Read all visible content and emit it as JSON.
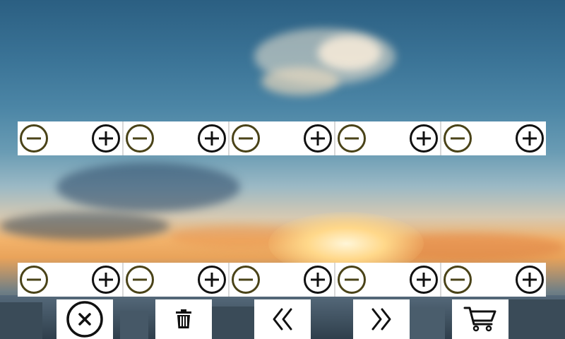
{
  "app": {
    "title": ""
  },
  "background": {
    "icon": "sunset-sky-background"
  },
  "stepper_rows": [
    {
      "steppers": [
        {
          "minus_icon": "minus-circle-icon",
          "plus_icon": "plus-circle-icon"
        },
        {
          "minus_icon": "minus-circle-icon",
          "plus_icon": "plus-circle-icon"
        },
        {
          "minus_icon": "minus-circle-icon",
          "plus_icon": "plus-circle-icon"
        },
        {
          "minus_icon": "minus-circle-icon",
          "plus_icon": "plus-circle-icon"
        },
        {
          "minus_icon": "minus-circle-icon",
          "plus_icon": "plus-circle-icon"
        }
      ]
    },
    {
      "steppers": [
        {
          "minus_icon": "minus-circle-icon",
          "plus_icon": "plus-circle-icon"
        },
        {
          "minus_icon": "minus-circle-icon",
          "plus_icon": "plus-circle-icon"
        },
        {
          "minus_icon": "minus-circle-icon",
          "plus_icon": "plus-circle-icon"
        },
        {
          "minus_icon": "minus-circle-icon",
          "plus_icon": "plus-circle-icon"
        },
        {
          "minus_icon": "minus-circle-icon",
          "plus_icon": "plus-circle-icon"
        }
      ]
    }
  ],
  "toolbar": {
    "buttons": [
      {
        "name": "close-button",
        "icon": "close-circle-icon"
      },
      {
        "name": "delete-button",
        "icon": "trash-icon"
      },
      {
        "name": "previous-button",
        "icon": "double-chevron-left-icon"
      },
      {
        "name": "next-button",
        "icon": "double-chevron-right-icon"
      },
      {
        "name": "cart-button",
        "icon": "cart-icon"
      }
    ]
  },
  "colors": {
    "minus_icon": "#4a4318",
    "plus_icon": "#111111",
    "button_bg": "#ffffff",
    "toolbar_icon": "#222222"
  }
}
